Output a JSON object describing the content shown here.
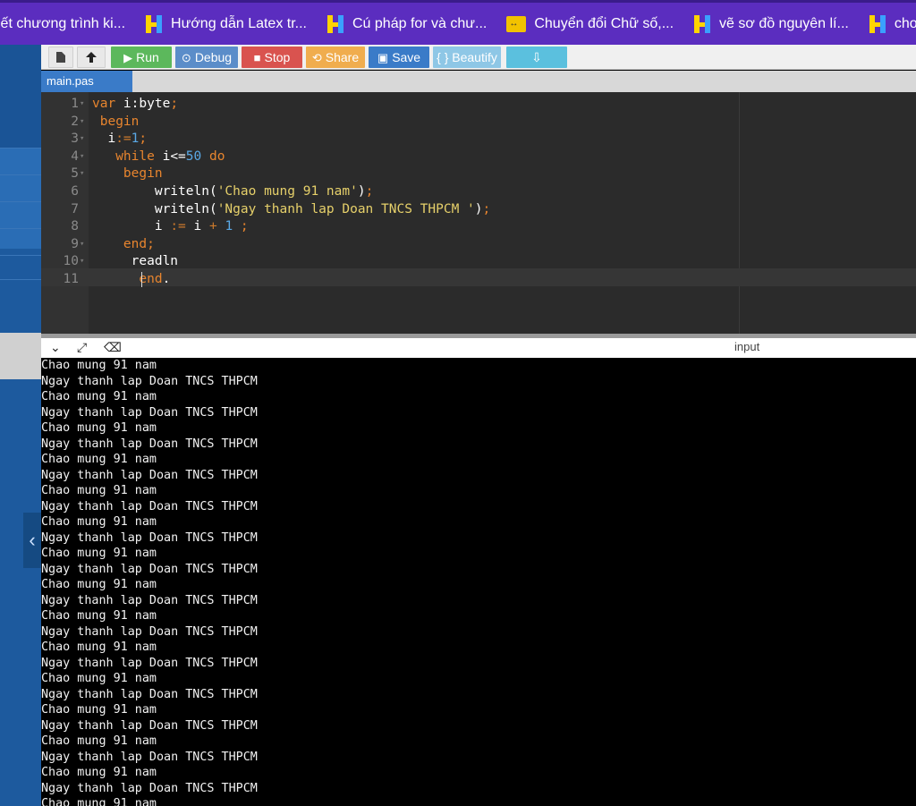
{
  "bookmarks": [
    {
      "label": "iết chương trình ki...",
      "icon": "hoc247-icon"
    },
    {
      "label": "Hướng dẫn Latex tr...",
      "icon": "hoc247-icon"
    },
    {
      "label": "Cú pháp for và chư...",
      "icon": "hoc247-icon"
    },
    {
      "label": "Chuyển đổi Chữ số,...",
      "icon": "swap-icon"
    },
    {
      "label": "vẽ sơ đồ nguyên lí...",
      "icon": "hoc247-icon"
    },
    {
      "label": "cho tam g",
      "icon": "hoc247-icon"
    }
  ],
  "toolbar": {
    "run": "Run",
    "debug": "Debug",
    "stop": "Stop",
    "share": "Share",
    "save": "Save",
    "beautify": "{ } Beautify",
    "colors": {
      "run": "#5cb85c",
      "debug": "#5b8dc9",
      "stop": "#d9534f",
      "share": "#f0ad4e",
      "save": "#3a7bc8",
      "beautify": "#8ec7e6",
      "download": "#5bc0de"
    }
  },
  "tab": {
    "filename": "main.pas"
  },
  "code_lines": [
    "var i:byte;",
    " begin",
    "  i:=1;",
    "   while i<=50 do",
    "    begin",
    "        writeln('Chao mung 91 nam');",
    "        writeln('Ngay thanh lap Doan TNCS THPCM ');",
    "        i := i + 1 ;",
    "    end;",
    "     readln",
    "      end."
  ],
  "line_numbers": [
    "1",
    "2",
    "3",
    "4",
    "5",
    "6",
    "7",
    "8",
    "9",
    "10",
    "11"
  ],
  "panel": {
    "input_label": "input"
  },
  "output_lines": [
    "Chao mung 91 nam",
    "Ngay thanh lap Doan TNCS THPCM",
    "Chao mung 91 nam",
    "Ngay thanh lap Doan TNCS THPCM",
    "Chao mung 91 nam",
    "Ngay thanh lap Doan TNCS THPCM",
    "Chao mung 91 nam",
    "Ngay thanh lap Doan TNCS THPCM",
    "Chao mung 91 nam",
    "Ngay thanh lap Doan TNCS THPCM",
    "Chao mung 91 nam",
    "Ngay thanh lap Doan TNCS THPCM",
    "Chao mung 91 nam",
    "Ngay thanh lap Doan TNCS THPCM",
    "Chao mung 91 nam",
    "Ngay thanh lap Doan TNCS THPCM",
    "Chao mung 91 nam",
    "Ngay thanh lap Doan TNCS THPCM",
    "Chao mung 91 nam",
    "Ngay thanh lap Doan TNCS THPCM",
    "Chao mung 91 nam",
    "Ngay thanh lap Doan TNCS THPCM",
    "Chao mung 91 nam",
    "Ngay thanh lap Doan TNCS THPCM",
    "Chao mung 91 nam",
    "Ngay thanh lap Doan TNCS THPCM",
    "Chao mung 91 nam",
    "Ngay thanh lap Doan TNCS THPCM",
    "Chao mung 91 nam"
  ]
}
